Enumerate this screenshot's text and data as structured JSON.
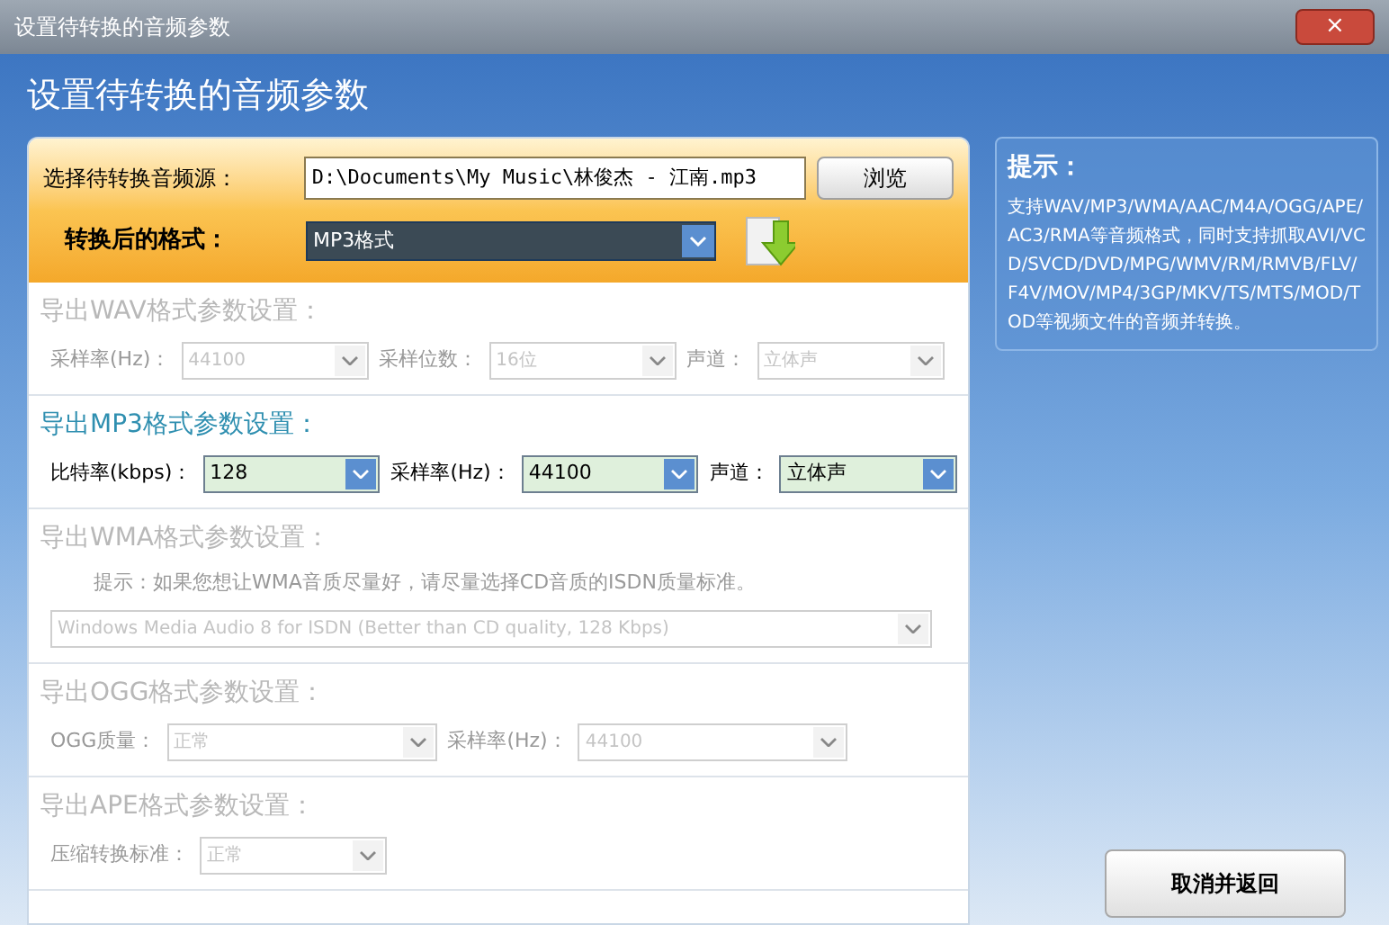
{
  "window": {
    "title": "设置待转换的音频参数",
    "close": "×"
  },
  "header": {
    "title": "设置待转换的音频参数"
  },
  "source": {
    "label": "选择待转换音频源：",
    "value": "D:\\Documents\\My Music\\林俊杰 - 江南.mp3",
    "browse": "浏览"
  },
  "format": {
    "label": "转换后的格式：",
    "value": "MP3格式"
  },
  "sections": [
    {
      "title": "导出WAV格式参数设置：",
      "enabled": false,
      "fields": [
        {
          "label": "采样率(Hz)：",
          "value": "44100"
        },
        {
          "label": "采样位数：",
          "value": "16位"
        },
        {
          "label": "声道：",
          "value": "立体声"
        }
      ]
    },
    {
      "title": "导出MP3格式参数设置：",
      "enabled": true,
      "fields": [
        {
          "label": "比特率(kbps)：",
          "value": "128"
        },
        {
          "label": "采样率(Hz)：",
          "value": "44100"
        },
        {
          "label": "声道：",
          "value": "立体声"
        }
      ]
    },
    {
      "title": "导出WMA格式参数设置：",
      "enabled": false,
      "hint": "提示：如果您想让WMA音质尽量好，请尽量选择CD音质的ISDN质量标准。",
      "fields": [
        {
          "value": "Windows Media Audio 8 for ISDN (Better than CD quality, 128 Kbps)"
        }
      ]
    },
    {
      "title": "导出OGG格式参数设置：",
      "enabled": false,
      "fields": [
        {
          "label": "OGG质量：",
          "value": "正常"
        },
        {
          "label": "采样率(Hz)：",
          "value": "44100"
        }
      ]
    },
    {
      "title": "导出APE格式参数设置：",
      "enabled": false,
      "fields": [
        {
          "label": "压缩转换标准：",
          "value": "正常"
        }
      ]
    }
  ],
  "tip": {
    "title": "提示：",
    "text": "支持WAV/MP3/WMA/AAC/M4A/OGG/APE/AC3/RMA等音频格式，同时支持抓取AVI/VCD/SVCD/DVD/MPG/WMV/RM/RMVB/FLV/F4V/MOV/MP4/3GP/MKV/TS/MTS/MOD/TOD等视频文件的音频并转换。"
  },
  "cancel_button": "取消并返回"
}
